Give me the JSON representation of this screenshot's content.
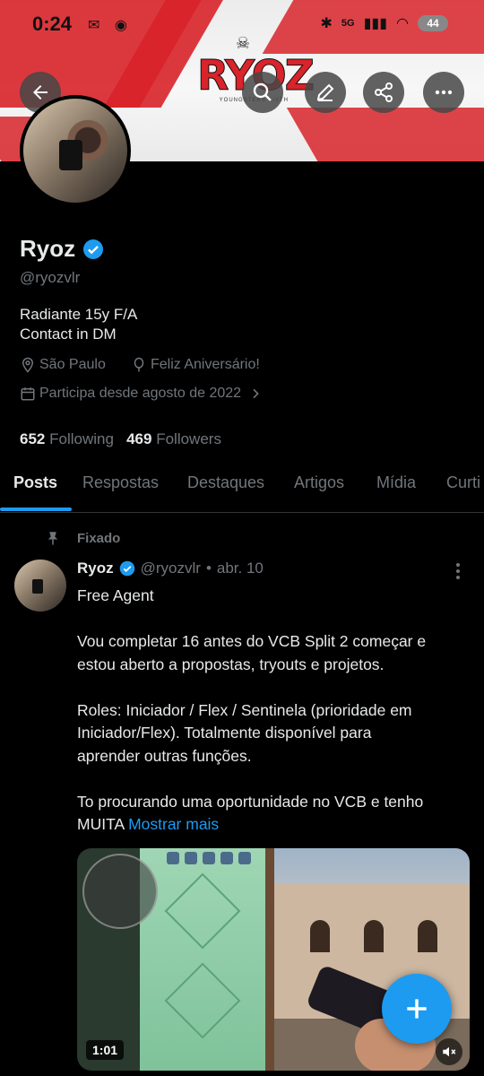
{
  "status_bar": {
    "time": "0:24",
    "network": "5G",
    "battery": "44"
  },
  "banner": {
    "logo_word": "RYOZ",
    "logo_sub": "YOUNGSTERS SIXTH"
  },
  "profile": {
    "name": "Ryoz",
    "handle": "@ryozvlr",
    "bio_line1": "Radiante 15y F/A",
    "bio_line2": "Contact in DM",
    "location": "São Paulo",
    "birthday": "Feliz Aniversário!",
    "joined": "Participa desde agosto de 2022",
    "following_count": "652",
    "following_label": "Following",
    "followers_count": "469",
    "followers_label": "Followers"
  },
  "tabs": [
    "Posts",
    "Respostas",
    "Destaques",
    "Artigos",
    "Mídia",
    "Curti"
  ],
  "post": {
    "pinned_label": "Fixado",
    "author": "Ryoz",
    "handle": "@ryozvlr",
    "separator": "•",
    "date": "abr. 10",
    "line1": "Free Agent",
    "line2": "Vou completar 16 antes do VCB Split 2 começar e",
    "line3": "estou aberto a propostas, tryouts e projetos.",
    "line4": "Roles: Iniciador / Flex / Sentinela (prioridade em",
    "line5": "Iniciador/Flex). Totalmente disponível para",
    "line6": "aprender outras funções.",
    "line7": "To procurando uma oportunidade no VCB e tenho",
    "line8": "MUITA",
    "show_more": "Mostrar mais",
    "video_duration": "1:01"
  },
  "colors": {
    "accent": "#1d9bf0",
    "brand_red": "#d8242a",
    "muted": "#71767b"
  }
}
